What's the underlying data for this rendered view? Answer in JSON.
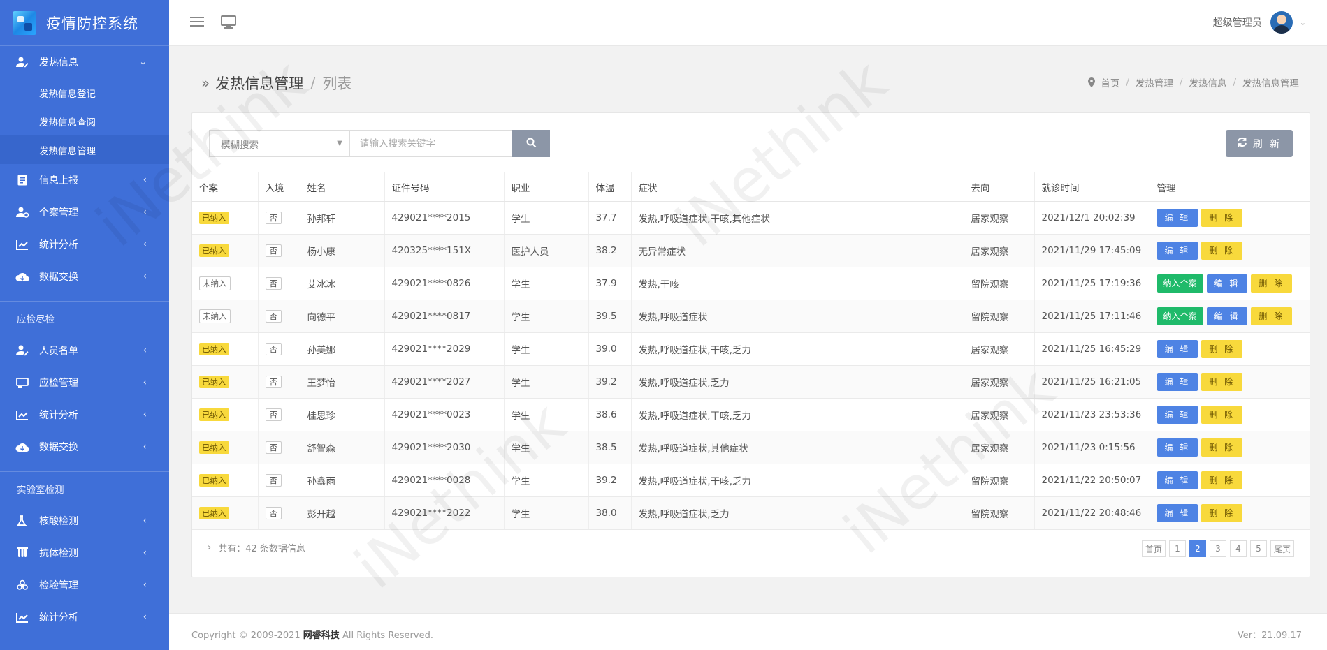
{
  "sidebar": {
    "brand": "疫情防控系统",
    "group1": {
      "open_menu": {
        "label": "发热信息",
        "icon": "user-edit-icon"
      },
      "sub_items": [
        "发热信息登记",
        "发热信息查阅",
        "发热信息管理"
      ],
      "items": [
        {
          "label": "信息上报",
          "icon": "report-icon"
        },
        {
          "label": "个案管理",
          "icon": "user-settings-icon"
        },
        {
          "label": "统计分析",
          "icon": "line-chart-icon"
        },
        {
          "label": "数据交换",
          "icon": "cloud-exchange-icon"
        }
      ]
    },
    "section2": {
      "title": "应检尽检",
      "items": [
        {
          "label": "人员名单",
          "icon": "user-edit-icon"
        },
        {
          "label": "应检管理",
          "icon": "board-icon"
        },
        {
          "label": "统计分析",
          "icon": "line-chart-icon"
        },
        {
          "label": "数据交换",
          "icon": "cloud-exchange-icon"
        }
      ]
    },
    "section3": {
      "title": "实验室检测",
      "items": [
        {
          "label": "核酸检测",
          "icon": "flask-icon"
        },
        {
          "label": "抗体检测",
          "icon": "test-tube-icon"
        },
        {
          "label": "检验管理",
          "icon": "biohazard-icon"
        },
        {
          "label": "统计分析",
          "icon": "line-chart-icon"
        }
      ]
    }
  },
  "header": {
    "user_name": "超级管理员"
  },
  "page": {
    "title": "发热信息管理",
    "separator": "/",
    "subtitle": "列表",
    "breadcrumb": [
      "首页",
      "发热管理",
      "发热信息",
      "发热信息管理"
    ]
  },
  "toolbar": {
    "select_value": "模糊搜索",
    "search_placeholder": "请输入搜索关键字",
    "refresh_label": "刷 新"
  },
  "table": {
    "headers": [
      "个案",
      "入境",
      "姓名",
      "证件号码",
      "职业",
      "体温",
      "症状",
      "去向",
      "就诊时间",
      "管理"
    ],
    "rows": [
      {
        "case": "已纳入",
        "entry": "否",
        "name": "孙邦轩",
        "id": "429021****2015",
        "job": "学生",
        "temp": "37.7",
        "symptom": "发热,呼吸道症状,干咳,其他症状",
        "dest": "居家观察",
        "time": "2021/12/1 20:02:39"
      },
      {
        "case": "已纳入",
        "entry": "否",
        "name": "杨小康",
        "id": "420325****151X",
        "job": "医护人员",
        "temp": "38.2",
        "symptom": "无异常症状",
        "dest": "居家观察",
        "time": "2021/11/29 17:45:09"
      },
      {
        "case": "未纳入",
        "entry": "否",
        "name": "艾冰冰",
        "id": "429021****0826",
        "job": "学生",
        "temp": "37.9",
        "symptom": "发热,干咳",
        "dest": "留院观察",
        "time": "2021/11/25 17:19:36"
      },
      {
        "case": "未纳入",
        "entry": "否",
        "name": "向德平",
        "id": "429021****0817",
        "job": "学生",
        "temp": "39.5",
        "symptom": "发热,呼吸道症状",
        "dest": "留院观察",
        "time": "2021/11/25 17:11:46"
      },
      {
        "case": "已纳入",
        "entry": "否",
        "name": "孙美娜",
        "id": "429021****2029",
        "job": "学生",
        "temp": "39.0",
        "symptom": "发热,呼吸道症状,干咳,乏力",
        "dest": "居家观察",
        "time": "2021/11/25 16:45:29"
      },
      {
        "case": "已纳入",
        "entry": "否",
        "name": "王梦怡",
        "id": "429021****2027",
        "job": "学生",
        "temp": "39.2",
        "symptom": "发热,呼吸道症状,乏力",
        "dest": "居家观察",
        "time": "2021/11/25 16:21:05"
      },
      {
        "case": "已纳入",
        "entry": "否",
        "name": "桂思珍",
        "id": "429021****0023",
        "job": "学生",
        "temp": "38.6",
        "symptom": "发热,呼吸道症状,干咳,乏力",
        "dest": "居家观察",
        "time": "2021/11/23 23:53:36"
      },
      {
        "case": "已纳入",
        "entry": "否",
        "name": "舒智森",
        "id": "429021****2030",
        "job": "学生",
        "temp": "38.5",
        "symptom": "发热,呼吸道症状,其他症状",
        "dest": "居家观察",
        "time": "2021/11/23 0:15:56"
      },
      {
        "case": "已纳入",
        "entry": "否",
        "name": "孙鑫雨",
        "id": "429021****0028",
        "job": "学生",
        "temp": "39.2",
        "symptom": "发热,呼吸道症状,干咳,乏力",
        "dest": "留院观察",
        "time": "2021/11/22 20:50:07"
      },
      {
        "case": "已纳入",
        "entry": "否",
        "name": "彭开越",
        "id": "429021****2022",
        "job": "学生",
        "temp": "38.0",
        "symptom": "发热,呼吸道症状,乏力",
        "dest": "留院观察",
        "time": "2021/11/22 20:48:46"
      }
    ],
    "actions": {
      "include": "纳入个案",
      "edit": "编 辑",
      "delete": "删 除"
    }
  },
  "summary": "共有：42 条数据信息",
  "pagination": [
    "首页",
    "1",
    "2",
    "3",
    "4",
    "5",
    "尾页"
  ],
  "footer": {
    "copyright_prefix": "Copyright © 2009-2021",
    "company": "网睿科技",
    "copyright_suffix": "All Rights Reserved.",
    "version": "Ver：21.09.17"
  },
  "watermark_text": "iNethink",
  "colors": {
    "sidebar": "#3f6fd8",
    "primary": "#4e83e4",
    "warning": "#f8d93c",
    "success": "#1fba6a"
  }
}
